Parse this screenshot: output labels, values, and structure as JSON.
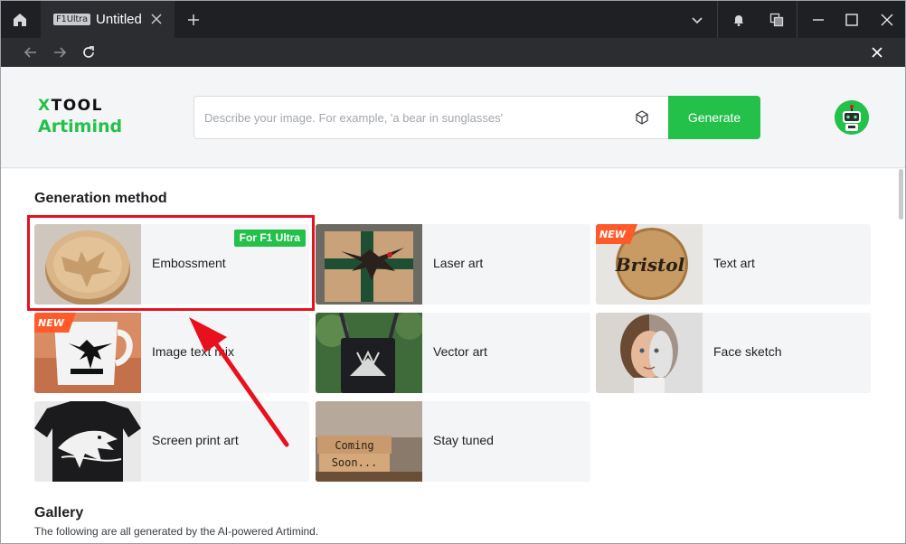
{
  "titlebar": {
    "tab_badge": "F1Ultra",
    "tab_title": "Untitled"
  },
  "header": {
    "logo_top": "TOOL",
    "logo_top_x": "X",
    "logo_bottom": "Artimind",
    "search_placeholder": "Describe your image. For example, 'a bear in sunglasses'",
    "generate_label": "Generate"
  },
  "main": {
    "section_title": "Generation method",
    "cards": [
      {
        "label": "Embossment",
        "badge": "For F1 Ultra"
      },
      {
        "label": "Laser art"
      },
      {
        "label": "Text art",
        "badge": "NEW"
      },
      {
        "label": "Image text mix",
        "badge": "NEW"
      },
      {
        "label": "Vector art"
      },
      {
        "label": "Face sketch"
      },
      {
        "label": "Screen print art"
      },
      {
        "label": "Stay tuned",
        "thumb_text_1": "Coming",
        "thumb_text_2": "Soon..."
      }
    ],
    "text_art_thumb": "Bristol",
    "gallery_title": "Gallery",
    "gallery_sub": "The following are all generated by the AI-powered Artimind."
  },
  "colors": {
    "brand_green": "#23c04a",
    "highlight_red": "#e8101d",
    "titlebar_bg": "#1f2023"
  }
}
